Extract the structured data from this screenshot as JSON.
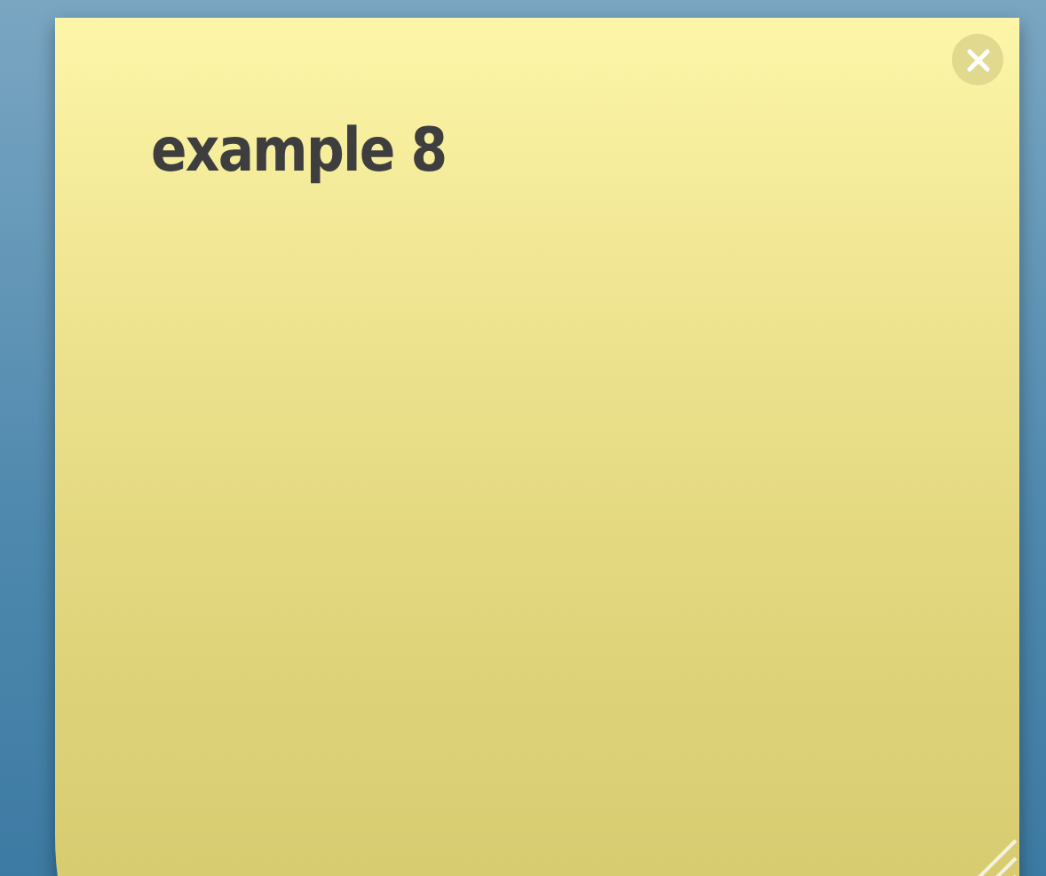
{
  "note": {
    "text": "example 8"
  }
}
